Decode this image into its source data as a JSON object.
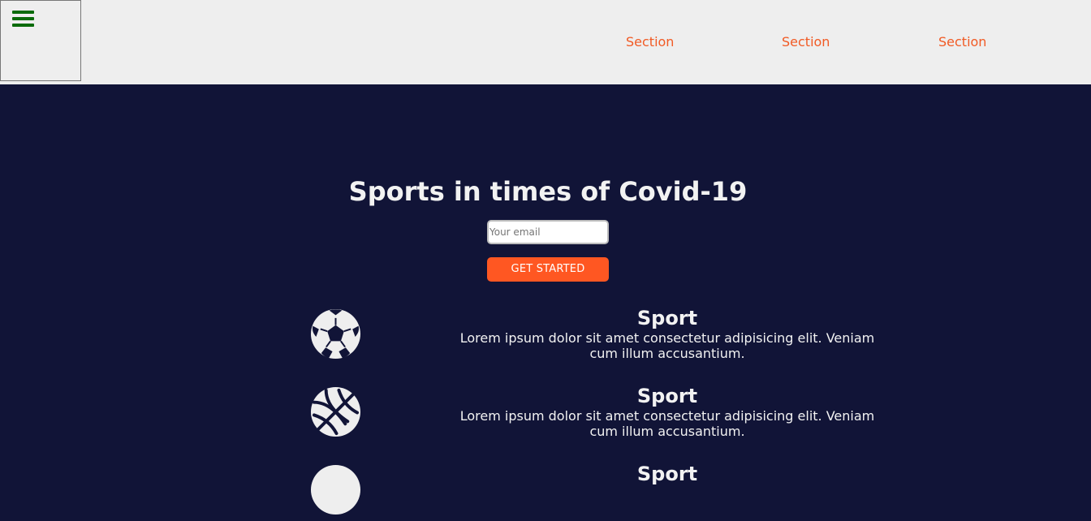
{
  "header": {
    "nav": [
      "Section",
      "Section",
      "Section"
    ]
  },
  "hero": {
    "title": "Sports in times of Covid-19",
    "email_placeholder": "Your email",
    "email_value": "",
    "cta_label": "GET STARTED"
  },
  "features": [
    {
      "icon": "soccer-ball-icon",
      "title": "Sport",
      "text": "Lorem ipsum dolor sit amet consectetur adipisicing elit. Veniam cum illum accusantium."
    },
    {
      "icon": "basketball-icon",
      "title": "Sport",
      "text": "Lorem ipsum dolor sit amet consectetur adipisicing elit. Veniam cum illum accusantium."
    },
    {
      "icon": "ball-icon",
      "title": "Sport",
      "text": ""
    }
  ],
  "colors": {
    "page_bg": "#111437",
    "header_bg": "#eeeeee",
    "accent": "#f15a24",
    "button": "#ff5722",
    "menu_icon": "#0a6b0a",
    "text": "#f2f2f2"
  }
}
